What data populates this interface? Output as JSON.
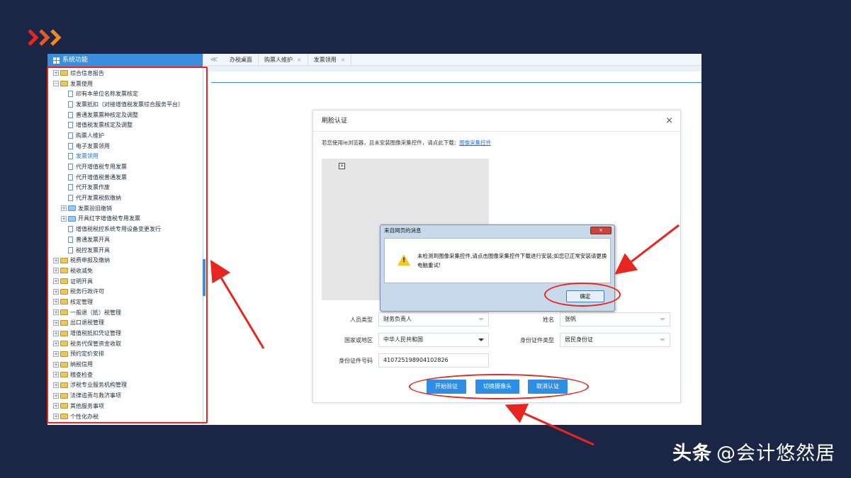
{
  "watermark": {
    "brand": "头条",
    "handle": "@会计悠然居"
  },
  "tree": {
    "header": "系统功能",
    "items": [
      {
        "label": "综合信息报告",
        "kind": "folder",
        "toggle": "+",
        "depth": 0
      },
      {
        "label": "发票使用",
        "kind": "folder",
        "toggle": "-",
        "depth": 0
      },
      {
        "label": "印有本单位名称发票核定",
        "kind": "doc",
        "depth": 1
      },
      {
        "label": "发票抵扣（对接增值税发票综合服务平台）",
        "kind": "doc",
        "depth": 1
      },
      {
        "label": "普通发票票种核定及调整",
        "kind": "doc",
        "depth": 1
      },
      {
        "label": "增值税发票核定及调整",
        "kind": "doc",
        "depth": 1
      },
      {
        "label": "购票人维护",
        "kind": "doc",
        "depth": 1
      },
      {
        "label": "电子发票领用",
        "kind": "doc",
        "depth": 1
      },
      {
        "label": "发票领用",
        "kind": "doc",
        "depth": 1,
        "selected": true
      },
      {
        "label": "代开增值税专用发票",
        "kind": "doc",
        "depth": 1
      },
      {
        "label": "代开增值税普通发票",
        "kind": "doc",
        "depth": 1
      },
      {
        "label": "代开发票作废",
        "kind": "doc",
        "depth": 1
      },
      {
        "label": "代开发票税款缴纳",
        "kind": "doc",
        "depth": 1
      },
      {
        "label": "发票验旧缴销",
        "kind": "folder-blue",
        "toggle": "+",
        "depth": 1
      },
      {
        "label": "开具红字增值税专用发票",
        "kind": "folder-blue",
        "toggle": "+",
        "depth": 1
      },
      {
        "label": "增值税税控系统专用设备变更发行",
        "kind": "doc",
        "depth": 1
      },
      {
        "label": "普通发票开具",
        "kind": "doc",
        "depth": 1
      },
      {
        "label": "税控发票开具",
        "kind": "doc",
        "depth": 1
      },
      {
        "label": "税费申报及缴纳",
        "kind": "folder",
        "toggle": "+",
        "depth": 0
      },
      {
        "label": "税收减免",
        "kind": "folder",
        "toggle": "+",
        "depth": 0
      },
      {
        "label": "证明开具",
        "kind": "folder",
        "toggle": "+",
        "depth": 0
      },
      {
        "label": "税务行政许可",
        "kind": "folder",
        "toggle": "+",
        "depth": 0
      },
      {
        "label": "核定管理",
        "kind": "folder",
        "toggle": "+",
        "depth": 0
      },
      {
        "label": "一般退（抵）税管理",
        "kind": "folder",
        "toggle": "+",
        "depth": 0
      },
      {
        "label": "出口退税管理",
        "kind": "folder",
        "toggle": "+",
        "depth": 0
      },
      {
        "label": "增值税抵扣凭证管理",
        "kind": "folder",
        "toggle": "+",
        "depth": 0
      },
      {
        "label": "税务代保管资金收取",
        "kind": "folder",
        "toggle": "+",
        "depth": 0
      },
      {
        "label": "预约定价安排",
        "kind": "folder",
        "toggle": "+",
        "depth": 0
      },
      {
        "label": "纳税信用",
        "kind": "folder",
        "toggle": "+",
        "depth": 0
      },
      {
        "label": "稽查检查",
        "kind": "folder",
        "toggle": "+",
        "depth": 0
      },
      {
        "label": "涉税专业服务机构管理",
        "kind": "folder",
        "toggle": "+",
        "depth": 0
      },
      {
        "label": "法律追责与救济事项",
        "kind": "folder",
        "toggle": "+",
        "depth": 0
      },
      {
        "label": "其他服务事项",
        "kind": "folder",
        "toggle": "+",
        "depth": 0
      },
      {
        "label": "个性化办税",
        "kind": "folder",
        "toggle": "+",
        "depth": 0
      }
    ]
  },
  "tabs": {
    "prev": "≪",
    "items": [
      {
        "label": "办税桌面",
        "closable": false
      },
      {
        "label": "购票人维护",
        "closable": true
      },
      {
        "label": "发票领用",
        "closable": true
      }
    ],
    "close_glyph": "×"
  },
  "dialog": {
    "title": "刷脸认证",
    "close": "×",
    "hint": "若您使用ie浏览器，且未安装图像采集控件，请点此下载：",
    "hint_link": "图像采集控件",
    "fields": {
      "person_type_label": "人员类型",
      "person_type_value": "财务负责人",
      "name_label": "姓名",
      "name_value": "张帆",
      "country_label": "国家或地区",
      "country_value": "中华人民共和国",
      "id_type_label": "身份证件类型",
      "id_type_value": "居民身份证",
      "id_number_label": "身份证件号码",
      "id_number_value": "410725198904102826"
    },
    "buttons": {
      "start": "开始验证",
      "switch": "切换摄像头",
      "cancel": "取消认证"
    }
  },
  "alert": {
    "title": "来自网页的消息",
    "close": "×",
    "message": "未检测到图像采集控件,请点击图像采集控件下载进行安装;如您已正常安装请更换电脑重试!",
    "ok": "确定"
  },
  "colors": {
    "accent": "#2d8ee6",
    "annotation": "#e8261f",
    "background": "#1b2546"
  }
}
